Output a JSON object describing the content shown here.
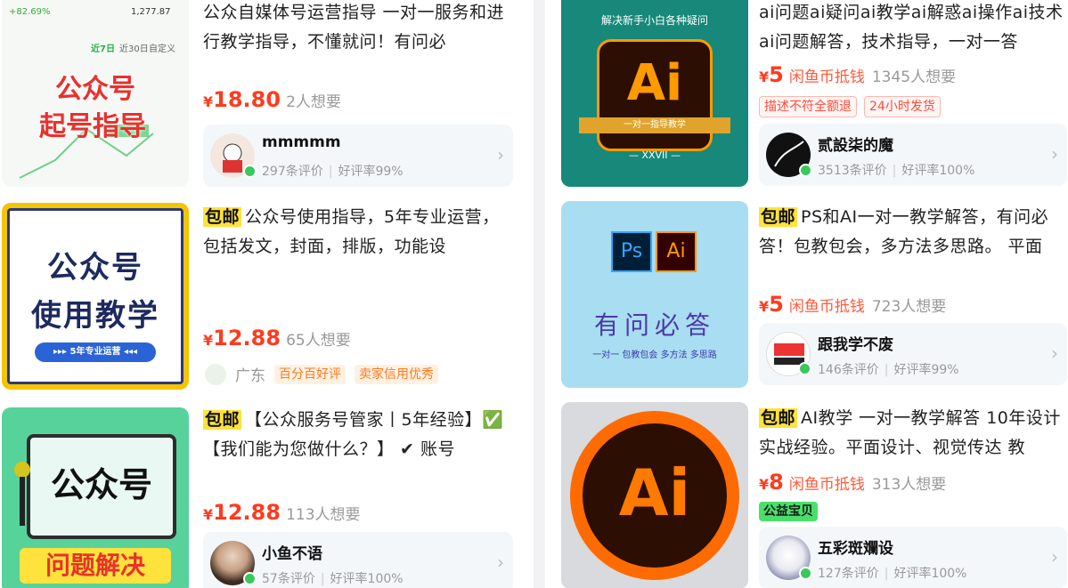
{
  "items": [
    {
      "title": "公众自媒体号运营指导 一对一服务和进行教学指导，不懂就问！有问必",
      "free_ship": "",
      "price_symbol": "¥",
      "price": "18.80",
      "price_note": "",
      "want": "2人想要",
      "thumb": {
        "line1": "公众号",
        "line2": "起号指导",
        "stat1": "+82.69%",
        "stat2": "1,277.87",
        "tab1": "近7日",
        "tab2": "近30日",
        "tab3": "自定义"
      },
      "seller": {
        "name": "mmmmm",
        "reviews": "297条评价",
        "rate": "好评率99%"
      }
    },
    {
      "title": "公众号使用指导，5年专业运营，包括发文，封面，排版，功能设",
      "free_ship": "包邮",
      "price_symbol": "¥",
      "price": "12.88",
      "price_note": "",
      "want": "65人想要",
      "thumb": {
        "line1": "公众号",
        "line2": "使用教学",
        "banner": "▸▸▸ 5年专业运营 ◂◂◂"
      },
      "location": "广东",
      "tags": [
        "百分百好评",
        "卖家信用优秀"
      ]
    },
    {
      "title": "【公众服务号管家丨5年经验】✅【我们能为您做什么？】 ✔ 账号",
      "free_ship": "包邮",
      "price_symbol": "¥",
      "price": "12.88",
      "price_note": "",
      "want": "113人想要",
      "thumb": {
        "line1": "公众号",
        "line2": "问题解决"
      },
      "seller": {
        "name": "小鱼不语",
        "reviews": "57条评价",
        "rate": "好评率100%"
      }
    },
    {
      "title": "ai问题ai疑问ai教学ai解惑ai操作ai技术 ai问题解答，技术指导，一对一答",
      "free_ship": "",
      "price_symbol": "¥",
      "price": "5",
      "price_note": "闲鱼币抵钱",
      "want": "1345人想要",
      "tags": [
        "描述不符全额退",
        "24小时发货"
      ],
      "thumb": {
        "top": "解决新手小白各种疑问",
        "logo": "Ai",
        "bar": "一对一指导教学",
        "bottom": "— XXVII —"
      },
      "seller": {
        "name": "贰設柒的魔",
        "reviews": "3513条评价",
        "rate": "好评率100%"
      }
    },
    {
      "title": "PS和AI一对一教学解答，有问必答！包教包会，多方法多思路。 平面",
      "free_ship": "包邮",
      "price_symbol": "¥",
      "price": "5",
      "price_note": "闲鱼币抵钱",
      "want": "723人想要",
      "thumb": {
        "ps": "Ps",
        "ai": "Ai",
        "main": "有问必答",
        "sub": "一对一 包教包会 多方法 多思路"
      },
      "seller": {
        "name": "跟我学不废",
        "reviews": "146条评价",
        "rate": "好评率99%"
      }
    },
    {
      "title": "AI教学 一对一教学解答 10年设计实战经验。平面设计、视觉传达 教",
      "free_ship": "包邮",
      "price_symbol": "¥",
      "price": "8",
      "price_note": "闲鱼币抵钱",
      "want": "313人想要",
      "tags": [
        "公益宝贝"
      ],
      "thumb": {
        "logo": "Ai"
      },
      "seller": {
        "name": "五彩斑斕设",
        "reviews": "127条评价",
        "rate": "好评率100%"
      }
    }
  ],
  "chevron": "›"
}
